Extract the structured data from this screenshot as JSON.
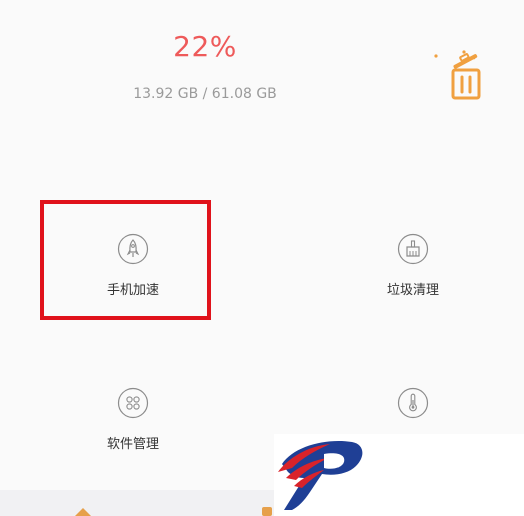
{
  "storage": {
    "percent": "22%",
    "detail": "13.92 GB / 61.08 GB"
  },
  "actions": {
    "clean_icon": "trash-bin-icon"
  },
  "tiles": [
    {
      "label": "手机加速",
      "icon": "rocket-icon"
    },
    {
      "label": "垃圾清理",
      "icon": "broom-icon"
    },
    {
      "label": "软件管理",
      "icon": "grid-apps-icon"
    },
    {
      "label": "",
      "icon": "thermometer-icon"
    }
  ],
  "colors": {
    "accent": "#ee5a5a",
    "trash_orange": "#f0a040",
    "highlight_red": "#e0121b",
    "icon_gray": "#8c8c8c"
  }
}
